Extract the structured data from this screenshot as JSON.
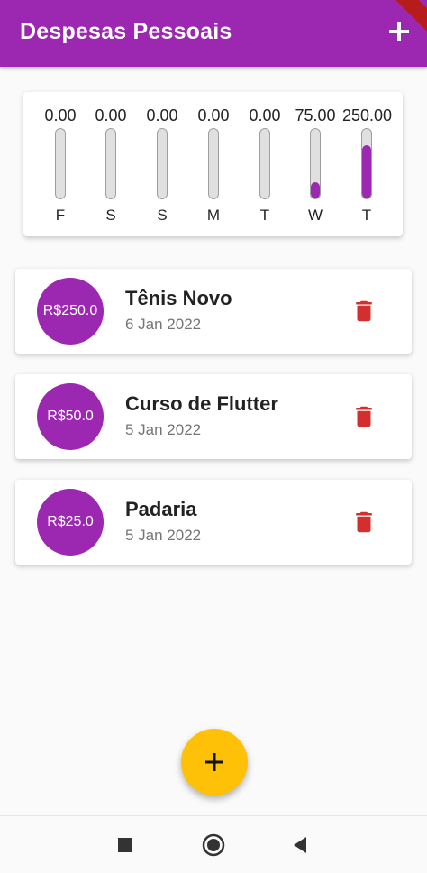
{
  "app": {
    "title": "Despesas Pessoais",
    "colors": {
      "primary": "#9c27b0",
      "accent": "#ffc107",
      "delete": "#d32f2f"
    },
    "add_icon": "plus-icon"
  },
  "chart": {
    "bars": [
      {
        "label": "0.00",
        "day": "F",
        "fraction": 0.0
      },
      {
        "label": "0.00",
        "day": "S",
        "fraction": 0.0
      },
      {
        "label": "0.00",
        "day": "S",
        "fraction": 0.0
      },
      {
        "label": "0.00",
        "day": "M",
        "fraction": 0.0
      },
      {
        "label": "0.00",
        "day": "T",
        "fraction": 0.0
      },
      {
        "label": "75.00",
        "day": "W",
        "fraction": 0.2308
      },
      {
        "label": "250.00",
        "day": "T",
        "fraction": 0.7692
      }
    ]
  },
  "transactions": [
    {
      "value": "R$250.0",
      "title": "Tênis Novo",
      "date": "6 Jan 2022",
      "delete_icon": "trash-icon"
    },
    {
      "value": "R$50.0",
      "title": "Curso de Flutter",
      "date": "5 Jan 2022",
      "delete_icon": "trash-icon"
    },
    {
      "value": "R$25.0",
      "title": "Padaria",
      "date": "5 Jan 2022",
      "delete_icon": "trash-icon"
    }
  ],
  "fab": {
    "icon": "plus-icon"
  },
  "navigation": {
    "icons": [
      "recents-square-icon",
      "home-circle-icon",
      "back-triangle-icon"
    ]
  }
}
